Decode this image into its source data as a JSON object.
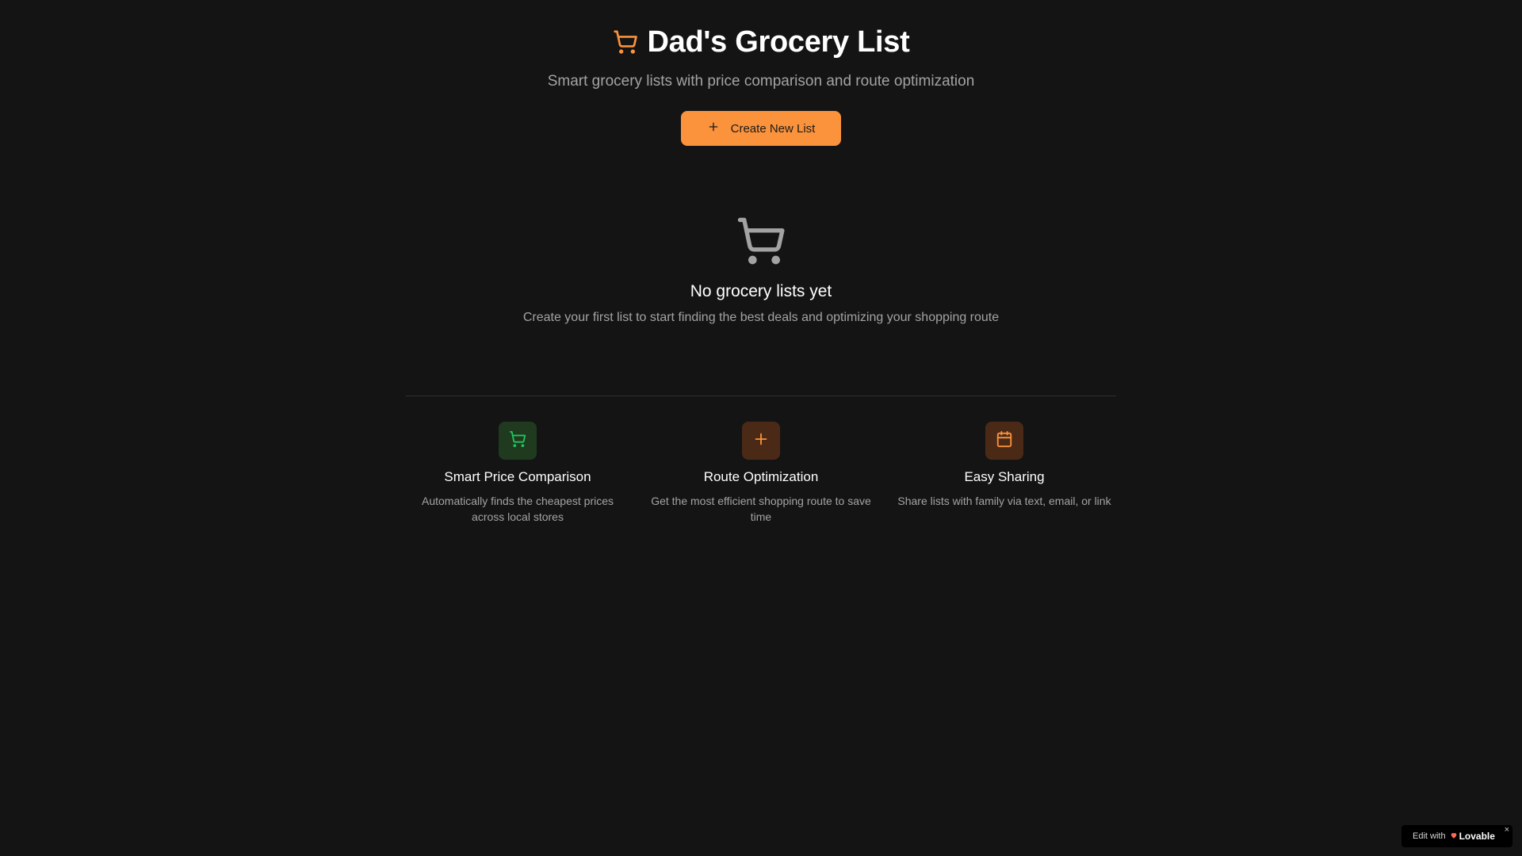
{
  "header": {
    "title": "Dad's Grocery List",
    "title_icon": "shopping-cart-icon",
    "subtitle": "Smart grocery lists with price comparison and route optimization"
  },
  "create_button": {
    "icon": "plus-icon",
    "label": "Create New List"
  },
  "empty_state": {
    "icon": "shopping-cart-icon",
    "title": "No grocery lists yet",
    "description": "Create your first list to start finding the best deals and optimizing your shopping route"
  },
  "features": [
    {
      "icon": "shopping-cart-icon",
      "title": "Smart Price Comparison",
      "description": "Automatically finds the cheapest prices across local stores"
    },
    {
      "icon": "plus-icon",
      "title": "Route Optimization",
      "description": "Get the most efficient shopping route to save time"
    },
    {
      "icon": "calendar-icon",
      "title": "Easy Sharing",
      "description": "Share lists with family via text, email, or link"
    }
  ],
  "badge": {
    "prefix": "Edit with",
    "brand": "Lovable",
    "close": "×"
  },
  "colors": {
    "background": "#141414",
    "accent_orange": "#fb923c",
    "accent_green": "#22c55e",
    "muted_text": "#a3a3a3"
  }
}
